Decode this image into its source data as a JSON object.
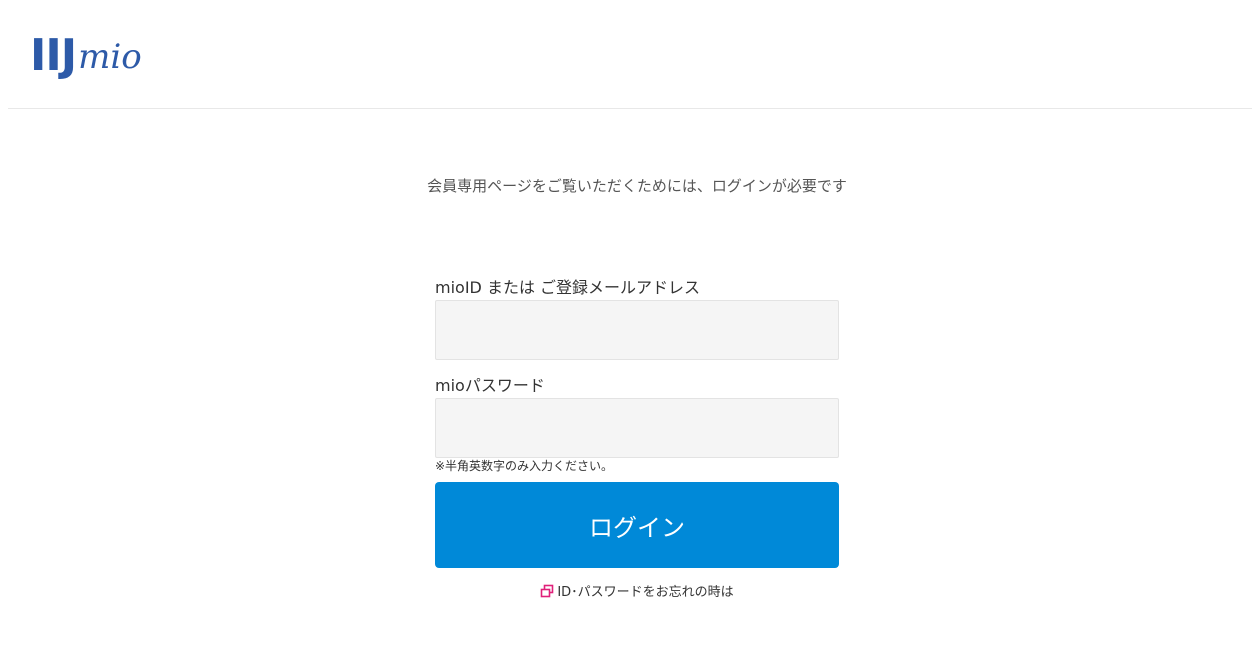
{
  "header": {
    "logo_ij": "IIJ",
    "logo_mio": "mio"
  },
  "intro": {
    "message": "会員専用ページをご覧いただくためには、ログインが必要です"
  },
  "form": {
    "email_label": "mioID または ご登録メールアドレス",
    "email_value": "",
    "password_label": "mioパスワード",
    "password_value": "",
    "password_hint": "※半角英数字のみ入力ください。",
    "login_button": "ログイン",
    "forgot_link": "ID･パスワードをお忘れの時は"
  },
  "icons": {
    "forgot_link_icon": "external-window-icon"
  },
  "colors": {
    "brand": "#2d5aa8",
    "button": "#0089d8",
    "link_icon": "#e0207a"
  }
}
